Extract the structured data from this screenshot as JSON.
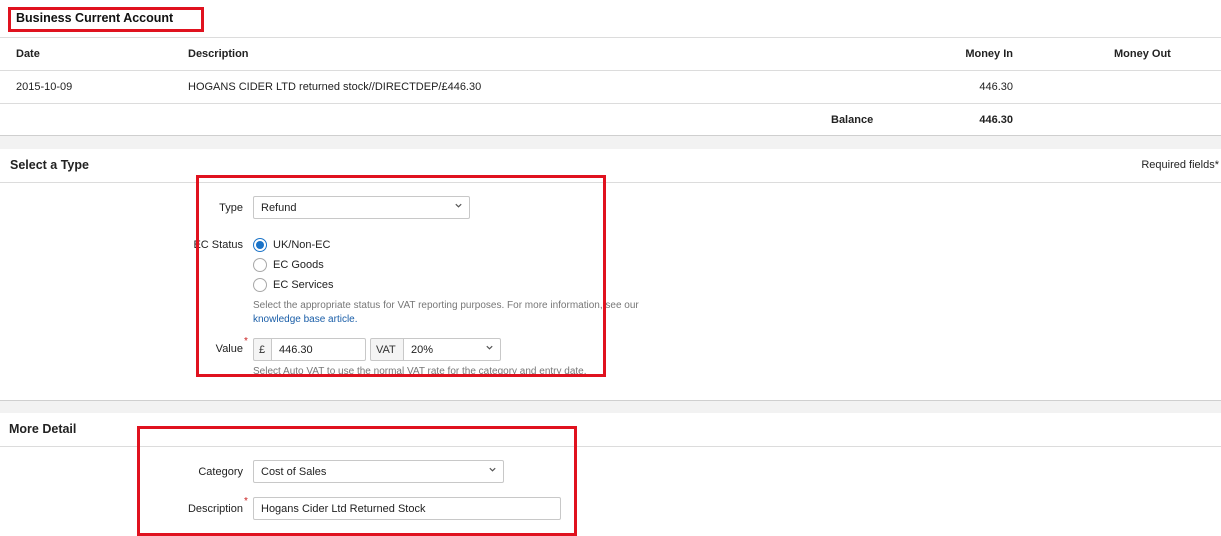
{
  "account": {
    "title": "Business Current Account"
  },
  "table": {
    "headers": {
      "date": "Date",
      "description": "Description",
      "money_in": "Money In",
      "money_out": "Money Out"
    },
    "rows": [
      {
        "date": "2015-10-09",
        "description": "HOGANS CIDER LTD returned stock//DIRECTDEP/£446.30",
        "money_in": "446.30",
        "money_out": ""
      }
    ],
    "balance_label": "Balance",
    "balance_value": "446.30"
  },
  "select_type": {
    "title": "Select a Type",
    "required_note": "Required fields*",
    "type_label": "Type",
    "type_value": "Refund",
    "ec_status_label": "EC Status",
    "ec_options": [
      "UK/Non-EC",
      "EC Goods",
      "EC Services"
    ],
    "ec_selected": "UK/Non-EC",
    "help_text": "Select the appropriate status for VAT reporting purposes. For more information, see our",
    "help_link": "knowledge base article.",
    "value_label": "Value",
    "currency_symbol": "£",
    "value_amount": "446.30",
    "vat_label": "VAT",
    "vat_value": "20%",
    "vat_help": "Select Auto VAT to use the normal VAT rate for the category and entry date."
  },
  "more_detail": {
    "title": "More Detail",
    "category_label": "Category",
    "category_value": "Cost of Sales",
    "description_label": "Description",
    "description_value": "Hogans Cider Ltd Returned Stock"
  },
  "colors": {
    "highlight": "#e0121f",
    "accent": "#1a73c8",
    "link": "#1a5ea8"
  }
}
